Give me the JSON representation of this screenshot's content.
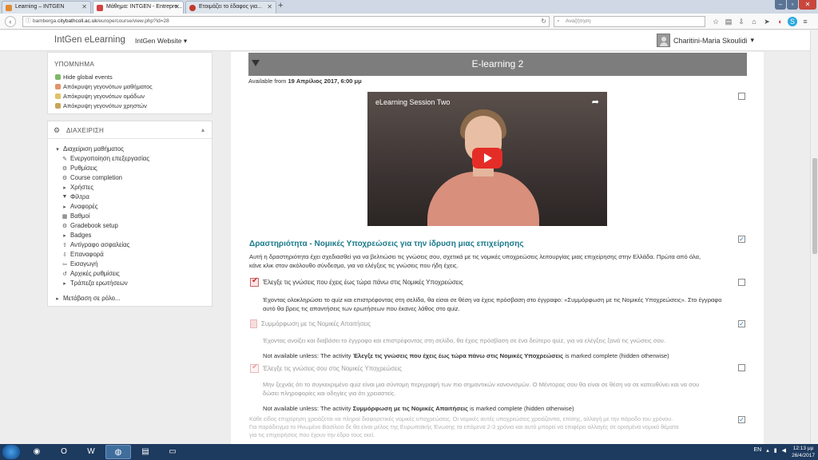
{
  "browser": {
    "tabs": [
      {
        "label": "Learning – INTGEN",
        "icon_color": "#e08a33",
        "active": false
      },
      {
        "label": "Μάθημα: INTGEN - Entrepre...",
        "icon_color": "#d34343",
        "active": true
      },
      {
        "label": "Ετοιμάζει το έδαφος για...",
        "icon_color": "#c0392b",
        "active": false
      }
    ],
    "new_tab": "+",
    "url_prefix": "bamberga.",
    "url_domain": "citybathcoll.ac.uk",
    "url_path": "/europe/course/view.php?id=28",
    "search_placeholder": "Αναζήτηση",
    "toolbar_icons": [
      "star-icon",
      "bookmarks-icon",
      "download-icon",
      "home-icon",
      "send-icon",
      "pocket-icon",
      "skype-icon",
      "menu-icon"
    ]
  },
  "header": {
    "brand": "IntGen eLearning",
    "site_menu": "IntGen Website",
    "site_menu_caret": "▾",
    "user_name": "Charitini-Maria Skoulidi",
    "user_caret": "▾"
  },
  "events_block": {
    "heading": "ΥΠΟΜΝΗΜΑ",
    "items": [
      {
        "label": "Hide global events",
        "color": "#7db86a"
      },
      {
        "label": "Απόκρυψη γεγονότων μαθήματος",
        "color": "#e0946a"
      },
      {
        "label": "Απόκρυψη γεγονότων ομάδων",
        "color": "#e0c06a"
      },
      {
        "label": "Απόκρυψη γεγονότων χρηστών",
        "color": "#c7a55c"
      }
    ]
  },
  "admin_block": {
    "title": "ΔΙΑΧΕΙΡΙΣΗ",
    "caret": "▴",
    "root": "Διαχείριση μαθήματος",
    "items": [
      {
        "label": "Ενεργοποίηση επεξεργασίας",
        "icon": "✎"
      },
      {
        "label": "Ρυθμίσεις",
        "icon": "⚙"
      },
      {
        "label": "Course completion",
        "icon": "⚙"
      },
      {
        "label": "Χρήστες",
        "icon": "▸"
      },
      {
        "label": "Φίλτρα",
        "icon": "▼"
      },
      {
        "label": "Αναφορές",
        "icon": "▸"
      },
      {
        "label": "Βαθμοί",
        "icon": "▦"
      },
      {
        "label": "Gradebook setup",
        "icon": "⚙"
      },
      {
        "label": "Badges",
        "icon": "▸"
      },
      {
        "label": "Αντίγραφο ασφαλείας",
        "icon": "⇪"
      },
      {
        "label": "Επαναφορά",
        "icon": "⇩"
      },
      {
        "label": "Εισαγωγή",
        "icon": "⇦"
      },
      {
        "label": "Αρχικές ρυθμίσεις",
        "icon": "↺"
      },
      {
        "label": "Τράπεζα ερωτήσεων",
        "icon": "▸"
      }
    ],
    "switch_role": "Μετάβαση σε ρόλο..."
  },
  "section": {
    "title": "E-learning 2",
    "available_prefix": "Available from ",
    "available_date": "19 Απρίλιος 2017, 6:00 μμ"
  },
  "video": {
    "title": "eLearning Session Two",
    "share_icon": "➦"
  },
  "activity": {
    "title": "Δραστηριότητα - Νομικές Υποχρεώσεις για την ίδρυση μιας επιχείρησης",
    "description_1": "Αυτή η δραστηριότητα έχει σχεδιασθεί για να βελτιώσει τις γνώσεις σου, σχετικά με τις νομικές υποχρεώσεις λειτουργίας μιας επιχείρησης στην Ελλάδα. Πρώτα από όλα,",
    "description_2": "κάνε κλικ στον ακόλουθο σύνδεσμο, για να ελέγξεις τις γνώσεις που ήδη έχεις.",
    "quiz1_label": "Έλεγξε τις γνώσεις που έχεις έως τώρα πάνω στις Νομικές Υποχρεώσεις",
    "quiz1_desc_1": "Έχοντας ολοκληρώσει το quiz και επιστρέφοντας στη σελίδα, θα είσαι σε θέση να έχεις πρόσβαση στο έγγραφο: «Συμμόρφωση με τις Νομικές Υποχρεώσεις». Στο έγγραφο",
    "quiz1_desc_2": "αυτό θα βρεις τις απαντήσεις των ερωτήσεων που έκανες λάθος στο quiz.",
    "doc_label": "Συμμόρφωση με τις Νομικές Απαιτήσεις",
    "doc_desc": "Έχοντας ανοίξει και διαβάσει το έγγραφο και επιστρέφοντας στη σελίδα, θα έχεις πρόσβαση σε ένα δεύτερο quiz, για να ελέγξεις ξανά τις γνώσεις σου.",
    "doc_restriction_prefix": "Not available unless: The activity ",
    "doc_restriction_bold": "Έλεγξε τις γνώσεις που έχεις έως τώρα πάνω στις Νομικές Υποχρεώσεις",
    "doc_restriction_suffix": " is marked complete (hidden otherwise)",
    "quiz2_label": "Έλεγξε τις γνώσεις σου στις Νομικές Υποχρεώσεις",
    "quiz2_desc_1": "Μην ξεχνάς ότι το συγκεκριμένο quiz είναι μια σύντομη περιγραφή των πιο σημαντικών κανονισμών. Ο Μέντορας σου θα είναι σε θέση να σε κατευθύνει και να σου",
    "quiz2_desc_2": "δώσει πληροφορίες και οδηγίες για ότι χρειαστείς.",
    "quiz2_restriction_prefix": "Not available unless: The activity ",
    "quiz2_restriction_bold": "Συμμόρφωση με τις Νομικές Απαιτήσεις",
    "quiz2_restriction_suffix": " is marked complete (hidden otherwise)",
    "footer_1": "Κάθε είδος επιχείρηση χρειάζεται να πληροί διαφορετικές νομικές υποχρεώσεις. Οι νομικές αυτές υποχρεώσεις χρειάζονται, επίσης, αλλαγή με την πάροδο του χρόνου.",
    "footer_2": "Για παράδειγμα το Ηνωμένο Βασίλειο δε θα είναι μέλος της Ευρωπαϊκής Ένωσης τα επόμενα 2-3 χρόνια και αυτό μπορεί να επιφέρει αλλαγές σε ορισμένα νομικά θέματα",
    "footer_3": "για τις επιχειρήσεις που έχουν την έδρα τους εκεί."
  },
  "taskbar": {
    "lang": "EN",
    "time": "12:13 μμ",
    "date": "26/4/2017"
  }
}
